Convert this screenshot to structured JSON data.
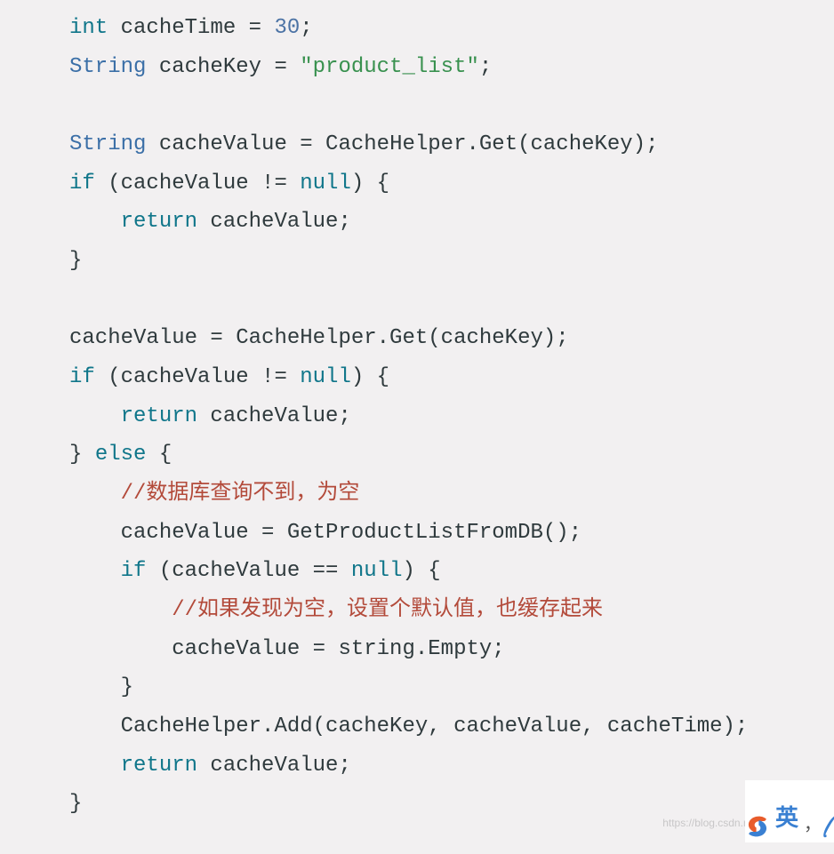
{
  "code": {
    "tokens": [
      [
        {
          "t": "kw",
          "v": "int"
        },
        {
          "t": "p",
          "v": " cacheTime = "
        },
        {
          "t": "num",
          "v": "30"
        },
        {
          "t": "p",
          "v": ";"
        }
      ],
      [
        {
          "t": "type",
          "v": "String"
        },
        {
          "t": "p",
          "v": " cacheKey = "
        },
        {
          "t": "str",
          "v": "\"product_list\""
        },
        {
          "t": "p",
          "v": ";"
        }
      ],
      [],
      [
        {
          "t": "type",
          "v": "String"
        },
        {
          "t": "p",
          "v": " cacheValue = CacheHelper.Get(cacheKey);"
        }
      ],
      [
        {
          "t": "kw",
          "v": "if"
        },
        {
          "t": "p",
          "v": " (cacheValue != "
        },
        {
          "t": "null",
          "v": "null"
        },
        {
          "t": "p",
          "v": ") {"
        }
      ],
      [
        {
          "t": "p",
          "v": "    "
        },
        {
          "t": "kw",
          "v": "return"
        },
        {
          "t": "p",
          "v": " cacheValue;"
        }
      ],
      [
        {
          "t": "p",
          "v": "}"
        }
      ],
      [],
      [
        {
          "t": "p",
          "v": "cacheValue = CacheHelper.Get(cacheKey);"
        }
      ],
      [
        {
          "t": "kw",
          "v": "if"
        },
        {
          "t": "p",
          "v": " (cacheValue != "
        },
        {
          "t": "null",
          "v": "null"
        },
        {
          "t": "p",
          "v": ") {"
        }
      ],
      [
        {
          "t": "p",
          "v": "    "
        },
        {
          "t": "kw",
          "v": "return"
        },
        {
          "t": "p",
          "v": " cacheValue;"
        }
      ],
      [
        {
          "t": "p",
          "v": "} "
        },
        {
          "t": "kw",
          "v": "else"
        },
        {
          "t": "p",
          "v": " {"
        }
      ],
      [
        {
          "t": "p",
          "v": "    "
        },
        {
          "t": "cmt",
          "v": "//数据库查询不到，为空"
        }
      ],
      [
        {
          "t": "p",
          "v": "    cacheValue = GetProductListFromDB();"
        }
      ],
      [
        {
          "t": "p",
          "v": "    "
        },
        {
          "t": "kw",
          "v": "if"
        },
        {
          "t": "p",
          "v": " (cacheValue == "
        },
        {
          "t": "null",
          "v": "null"
        },
        {
          "t": "p",
          "v": ") {"
        }
      ],
      [
        {
          "t": "p",
          "v": "        "
        },
        {
          "t": "cmt",
          "v": "//如果发现为空，设置个默认值，也缓存起来"
        }
      ],
      [
        {
          "t": "p",
          "v": "        cacheValue = string.Empty;"
        }
      ],
      [
        {
          "t": "p",
          "v": "    }"
        }
      ],
      [
        {
          "t": "p",
          "v": "    CacheHelper.Add(cacheKey, cacheValue, cacheTime);"
        }
      ],
      [
        {
          "t": "p",
          "v": "    "
        },
        {
          "t": "kw",
          "v": "return"
        },
        {
          "t": "p",
          "v": " cacheValue;"
        }
      ],
      [
        {
          "t": "p",
          "v": "}"
        }
      ]
    ]
  },
  "watermark": "https://blog.csdn.net/ba_wgn",
  "ime_char": "英"
}
